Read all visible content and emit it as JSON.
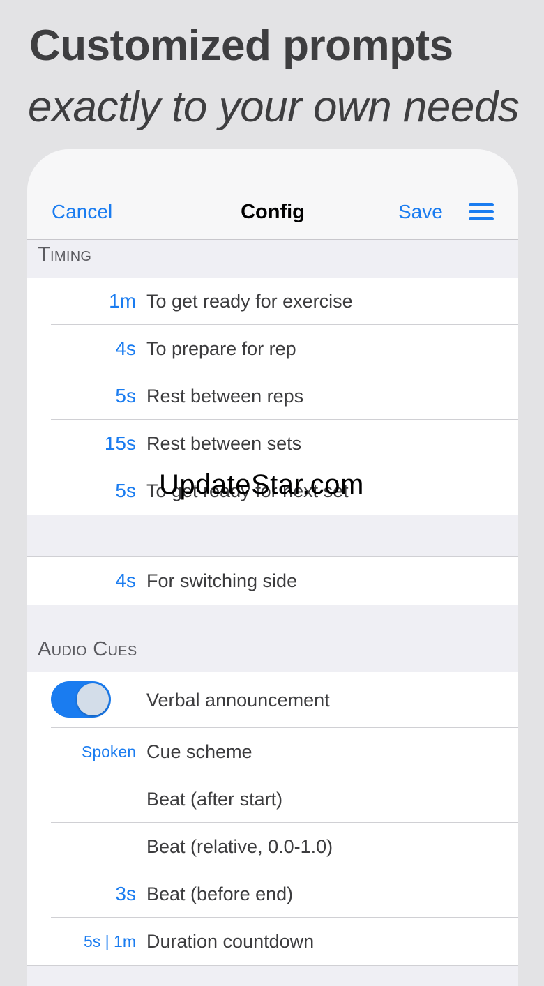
{
  "headline": "Customized prompts",
  "subheadline": "exactly to your own needs",
  "navbar": {
    "cancel": "Cancel",
    "title": "Config",
    "save": "Save",
    "menu_icon": "hamburger-menu-icon"
  },
  "timing": {
    "header": "Timing",
    "rows": [
      {
        "value": "1m",
        "label": "To get ready for exercise"
      },
      {
        "value": "4s",
        "label": "To prepare for rep"
      },
      {
        "value": "5s",
        "label": "Rest between reps"
      },
      {
        "value": "15s",
        "label": "Rest between sets"
      },
      {
        "value": "5s",
        "label": "To get ready for next set"
      }
    ],
    "switch_row": {
      "value": "4s",
      "label": "For switching side"
    }
  },
  "audio": {
    "header": "Audio Cues",
    "toggle": {
      "label": "Verbal announcement",
      "on": true
    },
    "rows": [
      {
        "value": "Spoken",
        "label": "Cue scheme"
      },
      {
        "value": "",
        "label": "Beat (after start)"
      },
      {
        "value": "",
        "label": "Beat (relative, 0.0-1.0)"
      },
      {
        "value": "3s",
        "label": "Beat (before end)"
      },
      {
        "value": "5s | 1m",
        "label": "Duration countdown"
      }
    ]
  },
  "watermark": "UpdateStar.com",
  "colors": {
    "accent": "#1a7cf0",
    "background": "#e3e3e5",
    "group_bg": "#efeff4"
  }
}
